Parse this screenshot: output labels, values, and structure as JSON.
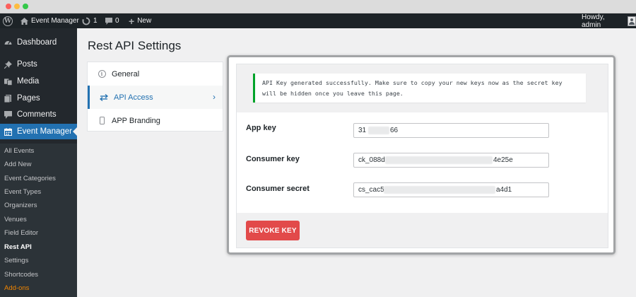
{
  "admin_bar": {
    "site_name": "Event Manager",
    "updates_count": "1",
    "comments_count": "0",
    "new_label": "New",
    "greeting": "Howdy, admin"
  },
  "sidebar": {
    "menu": [
      {
        "label": "Dashboard",
        "icon": "dashboard-icon"
      },
      {
        "label": "Posts",
        "icon": "pin-icon"
      },
      {
        "label": "Media",
        "icon": "media-icon"
      },
      {
        "label": "Pages",
        "icon": "pages-icon"
      },
      {
        "label": "Comments",
        "icon": "comment-icon"
      },
      {
        "label": "Event Manager",
        "icon": "calendar-icon"
      }
    ],
    "submenu": [
      "All Events",
      "Add New",
      "Event Categories",
      "Event Types",
      "Organizers",
      "Venues",
      "Field Editor",
      "Rest API",
      "Settings",
      "Shortcodes",
      "Add-ons"
    ]
  },
  "page": {
    "title": "Rest API Settings"
  },
  "tabs": [
    {
      "label": "General",
      "icon": "info-icon"
    },
    {
      "label": "API Access",
      "icon": "swap-arrows-icon"
    },
    {
      "label": "APP Branding",
      "icon": "phone-icon"
    }
  ],
  "notice": {
    "text": "API Key generated successfully. Make sure to copy your new keys now as the secret key will be hidden once you leave this page."
  },
  "fields": {
    "app_key": {
      "label": "App key",
      "value": "31",
      "value_end": "66"
    },
    "consumer_key": {
      "label": "Consumer key",
      "value": "ck_088d",
      "value_end": "4e25e"
    },
    "consumer_secret": {
      "label": "Consumer secret",
      "value": "cs_cac5",
      "value_end": "a4d1"
    }
  },
  "revoke_label": "REVOKE KEY",
  "colors": {
    "accent": "#2271b1",
    "success": "#00a32a",
    "danger": "#e24a4a",
    "admin_dark": "#1d2327"
  }
}
